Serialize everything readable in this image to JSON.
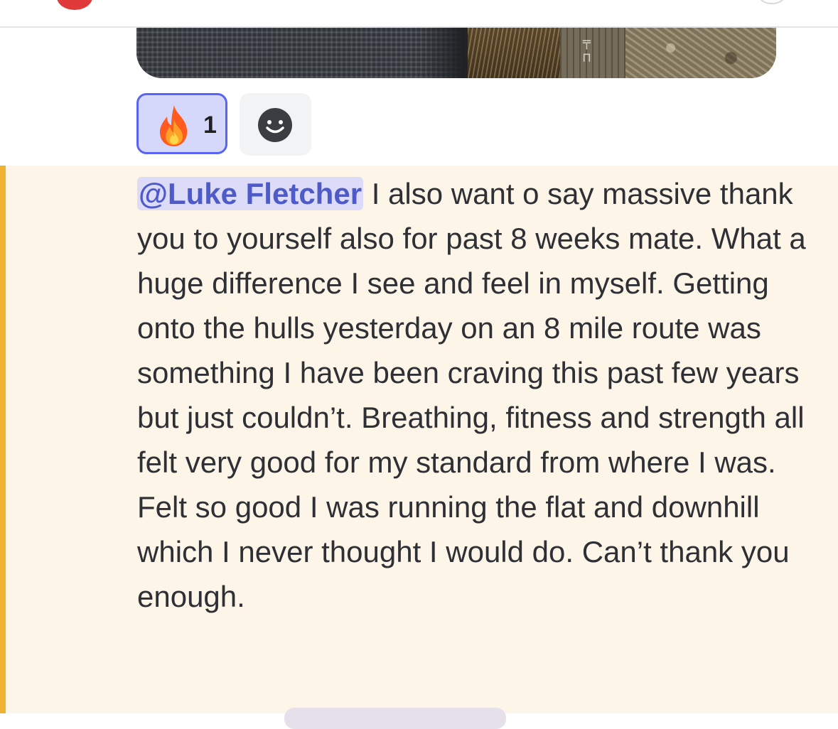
{
  "reactions": {
    "fire": {
      "icon": "fire-icon",
      "count": "1"
    },
    "add_reaction": {
      "icon": "smile-add-reaction-icon"
    }
  },
  "message": {
    "mention": "@Luke Fletcher",
    "text": " I also want o say massive thank you to yourself also for past 8 weeks mate. What a huge difference I see and feel in myself. Getting onto the hulls yesterday on an 8 mile route was something I have been craving this past few years but just couldn’t. Breathing, fitness and strength all felt very good for my standard from where I was. Felt so good I was running the flat and downhill which I never thought I would do. Can’t thank you enough."
  },
  "colors": {
    "mention_text": "#4e5ac7",
    "mention_bg": "#dcdcf8",
    "highlight_bg": "#fcf5e8",
    "highlight_bar": "#f0b232",
    "reaction_selected_border": "#5865f2",
    "reaction_selected_bg": "#d6d8fb"
  }
}
